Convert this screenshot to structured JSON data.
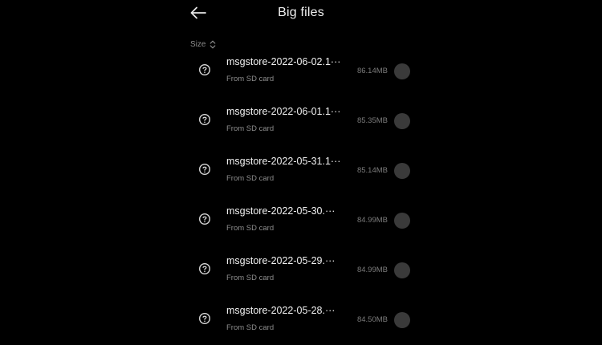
{
  "header": {
    "title": "Big files",
    "back_icon": "arrow-left-icon"
  },
  "sort": {
    "label": "Size",
    "icon": "sort-up-down-icon"
  },
  "colors": {
    "background": "#000000",
    "text_primary": "#f0f0f0",
    "text_secondary": "#8d8d8d",
    "select_circle": "#3a3a3a"
  },
  "files": [
    {
      "name": "msgstore-2022-06-02.1···",
      "source": "From SD card",
      "size": "86.14MB",
      "icon": "unknown-file-icon"
    },
    {
      "name": "msgstore-2022-06-01.1···",
      "source": "From SD card",
      "size": "85.35MB",
      "icon": "unknown-file-icon"
    },
    {
      "name": "msgstore-2022-05-31.1···",
      "source": "From SD card",
      "size": "85.14MB",
      "icon": "unknown-file-icon"
    },
    {
      "name": "msgstore-2022-05-30.···",
      "source": "From SD card",
      "size": "84.99MB",
      "icon": "unknown-file-icon"
    },
    {
      "name": "msgstore-2022-05-29.···",
      "source": "From SD card",
      "size": "84.99MB",
      "icon": "unknown-file-icon"
    },
    {
      "name": "msgstore-2022-05-28.···",
      "source": "From SD card",
      "size": "84.50MB",
      "icon": "unknown-file-icon"
    }
  ]
}
